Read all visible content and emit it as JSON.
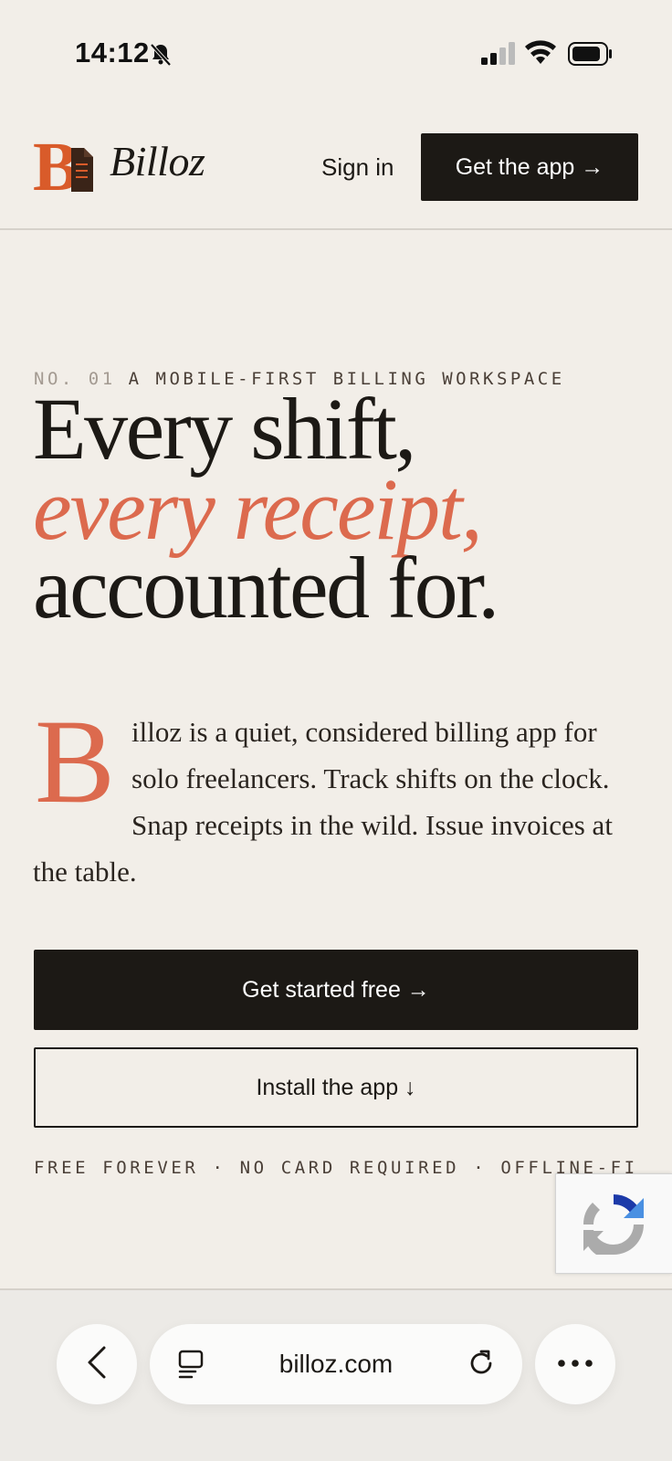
{
  "status": {
    "time": "14:12"
  },
  "header": {
    "brand": "Billoz",
    "sign_in": "Sign in",
    "get_app": "Get the app →"
  },
  "hero": {
    "eyebrow_num": "NO. 01",
    "eyebrow_text": "A MOBILE-FIRST BILLING WORKSPACE",
    "headline_1": "Every shift,",
    "headline_2": "every receipt,",
    "headline_3": "accounted for.",
    "dropcap": "B",
    "lede": "illoz is a quiet, considered billing app for solo freelancers. Track shifts on the clock. Snap receipts in the wild. Issue invoices at the table.",
    "cta_primary": "Get started free →",
    "cta_secondary": "Install the app ↓",
    "note": "FREE FOREVER · NO CARD REQUIRED · OFFLINE-FIRST"
  },
  "browser": {
    "url": "billoz.com"
  },
  "colors": {
    "accent": "#dc6a4e",
    "ink": "#1c1915",
    "paper": "#f2eee8"
  },
  "icons": [
    "bell-slash-icon",
    "cellular-signal-icon",
    "wifi-icon",
    "battery-icon",
    "billoz-logo",
    "recaptcha-icon",
    "back-chevron-icon",
    "tabs-icon",
    "reload-icon",
    "more-icon"
  ]
}
